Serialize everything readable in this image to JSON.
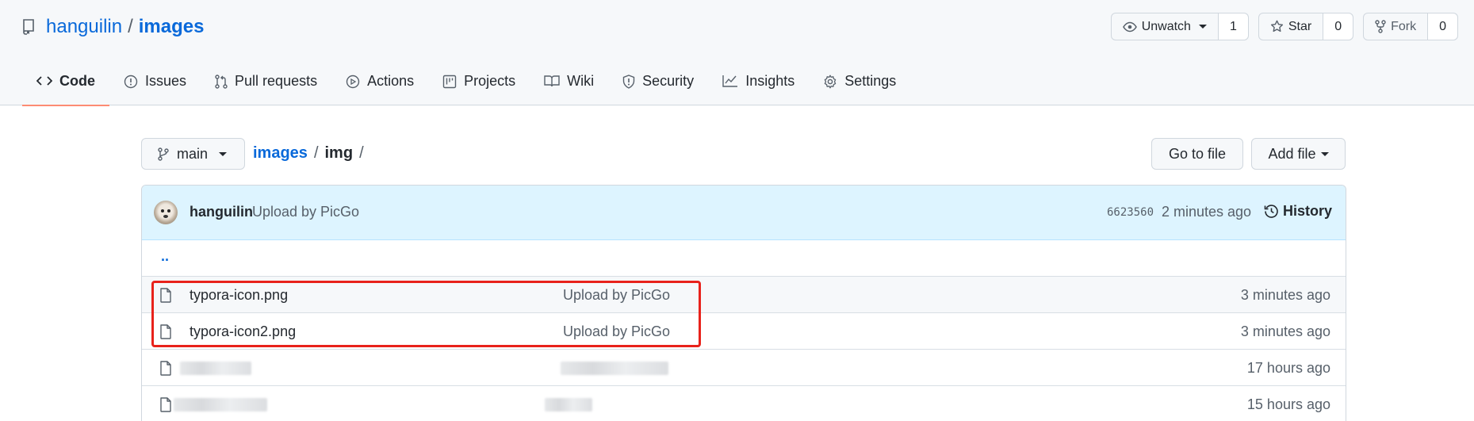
{
  "repo": {
    "owner": "hanguilin",
    "separator": "/",
    "name": "images"
  },
  "actions": {
    "watch": {
      "label": "Unwatch",
      "count": "1"
    },
    "star": {
      "label": "Star",
      "count": "0"
    },
    "fork": {
      "label": "Fork",
      "count": "0"
    }
  },
  "tabs": [
    {
      "label": "Code",
      "icon": "code-icon",
      "active": true
    },
    {
      "label": "Issues",
      "icon": "issue-icon"
    },
    {
      "label": "Pull requests",
      "icon": "pull-request-icon"
    },
    {
      "label": "Actions",
      "icon": "play-icon"
    },
    {
      "label": "Projects",
      "icon": "project-icon"
    },
    {
      "label": "Wiki",
      "icon": "book-icon"
    },
    {
      "label": "Security",
      "icon": "shield-icon"
    },
    {
      "label": "Insights",
      "icon": "graph-icon"
    },
    {
      "label": "Settings",
      "icon": "gear-icon"
    }
  ],
  "filenav": {
    "branch": "main",
    "breadcrumb": {
      "root": "images",
      "sep": "/",
      "current": "img",
      "trailing": "/"
    },
    "goto_file": "Go to file",
    "add_file": "Add file"
  },
  "commit": {
    "author": "hanguilin",
    "message": "Upload by PicGo",
    "hash": "6623560",
    "time": "2 minutes ago",
    "history": "History"
  },
  "files": {
    "up": "..",
    "rows": [
      {
        "name": "typora-icon.png",
        "message": "Upload by PicGo",
        "time": "3 minutes ago"
      },
      {
        "name": "typora-icon2.png",
        "message": "Upload by PicGo",
        "time": "3 minutes ago"
      },
      {
        "name": "",
        "message": "",
        "time": "17 hours ago",
        "blurred": true
      },
      {
        "name": "",
        "message": "",
        "time": "15 hours ago",
        "blurred": true
      }
    ]
  },
  "colors": {
    "link": "#0969da",
    "tab_underline": "#fd8c73",
    "commit_bar": "#ddf4ff",
    "highlight_box": "#e8221b"
  }
}
